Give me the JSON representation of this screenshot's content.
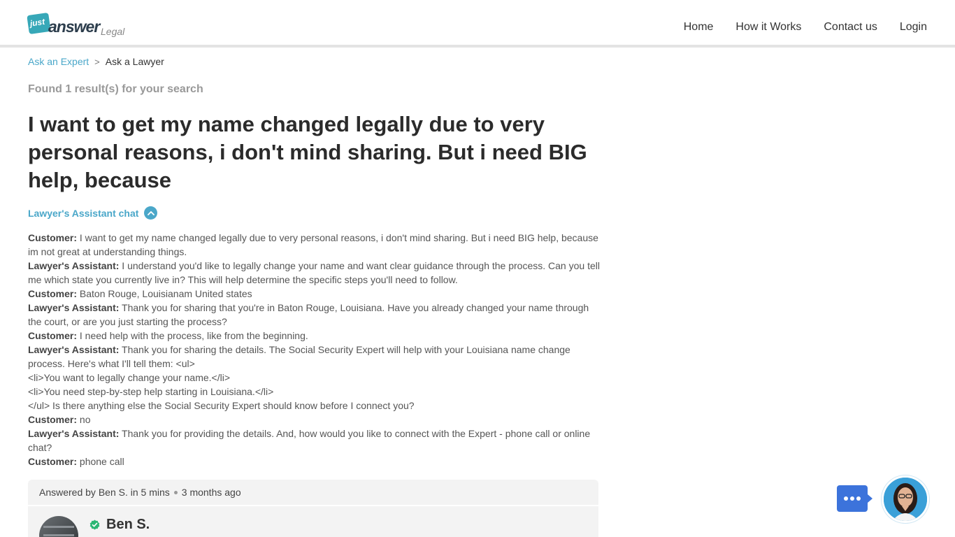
{
  "header": {
    "logo": {
      "badge": "just",
      "word": "answer",
      "sub": "Legal"
    },
    "nav": [
      "Home",
      "How it Works",
      "Contact us",
      "Login"
    ]
  },
  "breadcrumb": {
    "link": "Ask an Expert",
    "separator": ">",
    "current": "Ask a Lawyer"
  },
  "found_text": "Found 1 result(s) for your search",
  "question_title": "I want to get my name changed legally due to very personal reasons, i don't mind sharing. But i need BIG help, because",
  "chat_toggle_label": "Lawyer's Assistant chat",
  "transcript": [
    {
      "speaker": "Customer:",
      "text": " I want to get my name changed legally due to very personal reasons, i don't mind sharing. But i need BIG help, because im not great at understanding things."
    },
    {
      "speaker": "Lawyer's Assistant:",
      "text": " I understand you'd like to legally change your name and want clear guidance through the process. Can you tell me which state you currently live in? This will help determine the specific steps you'll need to follow."
    },
    {
      "speaker": "Customer:",
      "text": " Baton Rouge, Louisianam United states"
    },
    {
      "speaker": "Lawyer's Assistant:",
      "text": " Thank you for sharing that you're in Baton Rouge, Louisiana. Have you already changed your name through the court, or are you just starting the process?"
    },
    {
      "speaker": "Customer:",
      "text": " I need help with the process, like from the beginning."
    },
    {
      "speaker": "Lawyer's Assistant:",
      "text": " Thank you for sharing the details. The Social Security Expert will help with your Louisiana name change process. Here's what I'll tell them: <ul>"
    },
    {
      "speaker": "",
      "text": "<li>You want to legally change your name.</li>"
    },
    {
      "speaker": "",
      "text": "<li>You need step-by-step help starting in Louisiana.</li>"
    },
    {
      "speaker": "",
      "text": "</ul> Is there anything else the Social Security Expert should know before I connect you?"
    },
    {
      "speaker": "Customer:",
      "text": " no"
    },
    {
      "speaker": "Lawyer's Assistant:",
      "text": " Thank you for providing the details. And, how would you like to connect with the Expert - phone call or online chat?"
    },
    {
      "speaker": "Customer:",
      "text": " phone call"
    }
  ],
  "answer": {
    "answered_by": "Answered by Ben S. in 5 mins",
    "when": "3 months ago",
    "expert_name": "Ben S."
  },
  "colors": {
    "accent": "#4aa7c9",
    "chat_button": "#3c73db",
    "verified": "#2bb673"
  }
}
